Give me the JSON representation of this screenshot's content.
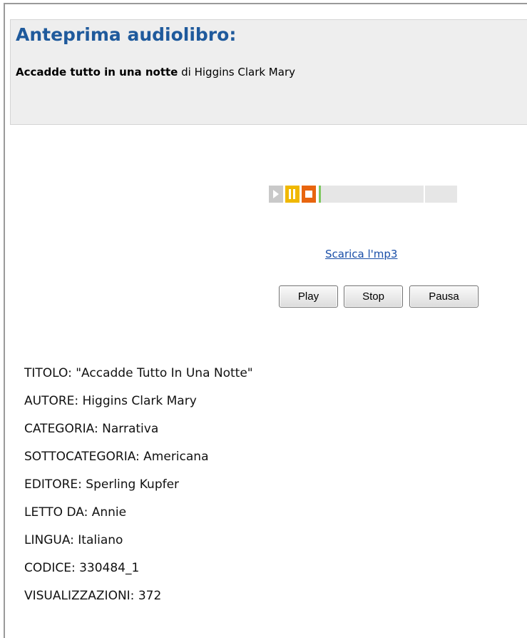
{
  "header": {
    "title": "Anteprima audiolibro:",
    "book_title": "Accadde tutto in una notte",
    "by_word": "di",
    "author": "Higgins Clark Mary"
  },
  "player": {
    "play_icon": "play-triangle-icon",
    "pause_icon": "pause-icon",
    "stop_icon": "stop-square-icon",
    "colors": {
      "play": "#c9c9c9",
      "pause": "#f0b800",
      "stop": "#e8650f",
      "progress": "#7ec85f",
      "track": "#e6e6e6"
    },
    "progress": 0
  },
  "download": {
    "label": "Scarica l'mp3"
  },
  "controls": {
    "play_label": "Play",
    "stop_label": "Stop",
    "pause_label": "Pausa"
  },
  "details": [
    "TITOLO: \"Accadde Tutto In Una Notte\"",
    "AUTORE: Higgins Clark Mary",
    "CATEGORIA: Narrativa",
    "SOTTOCATEGORIA: Americana",
    "EDITORE: Sperling Kupfer",
    "LETTO DA: Annie",
    "LINGUA: Italiano",
    "CODICE: 330484_1",
    "VISUALIZZAZIONI: 372"
  ],
  "colors": {
    "title": "#1f5a9c",
    "link": "#1a4fa8",
    "header_bg": "#eeeeee"
  }
}
